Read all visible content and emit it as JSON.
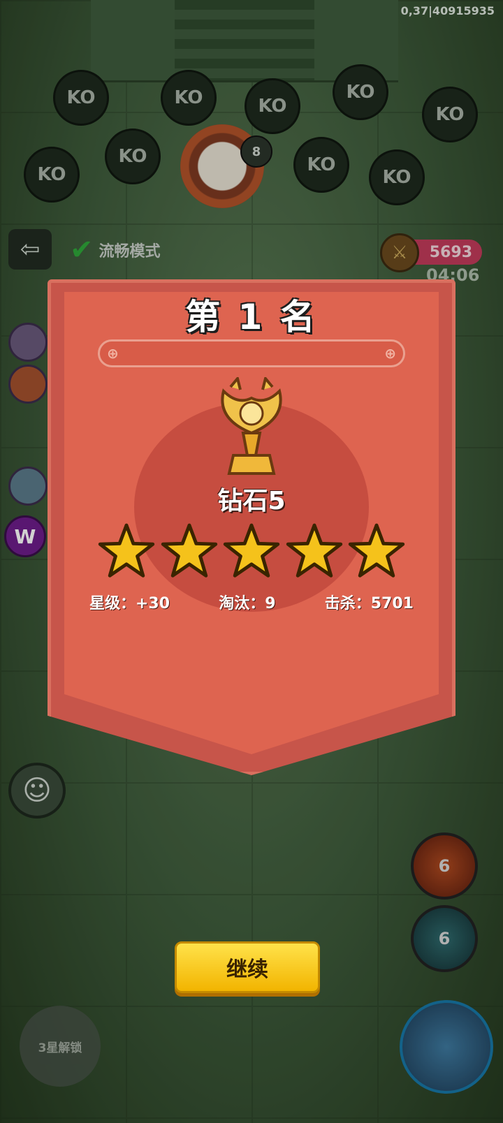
{
  "debug_text": "0,37|40915935",
  "ko_label": "KO",
  "boss": {
    "level": "8"
  },
  "hud": {
    "smooth_mode_label": "流畅模式",
    "score": "5693",
    "timer": "04:06"
  },
  "left_badges": {
    "w_badge": "W"
  },
  "skills": {
    "fire_count": "6",
    "ice_count": "6",
    "lock_label": "3星解锁"
  },
  "result": {
    "rank_title": "第 1 名",
    "tier": "钻石5",
    "stars": 5,
    "stats": {
      "star_level": "星级：+30",
      "eliminated": "淘汰：9",
      "kills": "击杀：5701"
    }
  },
  "continue_label": "继续",
  "icons": {
    "exit": "exit-icon",
    "check": "check-icon",
    "sword": "sword-icon",
    "emoji": "smile-icon",
    "trophy": "dragon-trophy-icon",
    "star": "star-icon"
  },
  "colors": {
    "panel": "#c7554a",
    "button": "#f2b400",
    "star": "#f5c21b"
  }
}
